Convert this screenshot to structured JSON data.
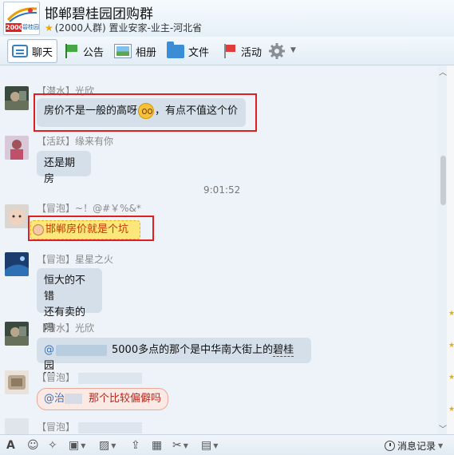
{
  "header": {
    "logo": {
      "badge": "2000",
      "brand": "碧桂园"
    },
    "title": "邯郸碧桂园团购群",
    "subtitle": "(2000人群) 置业安家-业主-河北省"
  },
  "toolbar": {
    "tabs": [
      {
        "label": "聊天",
        "icon": "chat-icon",
        "active": true
      },
      {
        "label": "公告",
        "icon": "announcement-flag-icon"
      },
      {
        "label": "相册",
        "icon": "photo-album-icon"
      },
      {
        "label": "文件",
        "icon": "folder-icon"
      },
      {
        "label": "活动",
        "icon": "event-flag-icon"
      }
    ],
    "settings_icon": "gear-icon"
  },
  "messages": [
    {
      "rank": "【潜水】",
      "name": "光欣",
      "text_before": "房价不是一般的高呀",
      "emoji": "sad-face-icon",
      "text_after": "，有点不值这个价",
      "highlighted": true
    },
    {
      "rank": "【活跃】",
      "name": "缘来有你",
      "text": "还是期房"
    },
    {
      "time": "9:01:52"
    },
    {
      "rank": "【冒泡】",
      "name": "~！@#￥%&*",
      "text": "邯郸房价就是个坑",
      "style": "fun-bubble",
      "highlighted": true
    },
    {
      "rank": "【冒泡】",
      "name": "星星之火",
      "lines": [
        "恒大的不错",
        "还有卖的吗"
      ]
    },
    {
      "rank": "【潜水】",
      "name": "光欣",
      "mention": "@",
      "text": "5000多点的那个是中华南大街上的",
      "link": "碧桂园"
    },
    {
      "rank": "【冒泡】",
      "mention": "@治",
      "text": "那个比较偏僻吗",
      "style": "pink-bubble"
    },
    {
      "rank": "【冒泡】"
    }
  ],
  "bottom_toolbar": {
    "tools": [
      "font-icon",
      "emoji-icon",
      "magic-icon",
      "gift-icon",
      "image-icon",
      "screenshot-icon",
      "upload-icon",
      "clean-icon",
      "scissors-icon",
      "music-icon"
    ],
    "history_label": "消息记录"
  },
  "colors": {
    "accent": "#3a7fc0",
    "highlight_box": "#e02020",
    "bubble": "#d4dfea"
  }
}
